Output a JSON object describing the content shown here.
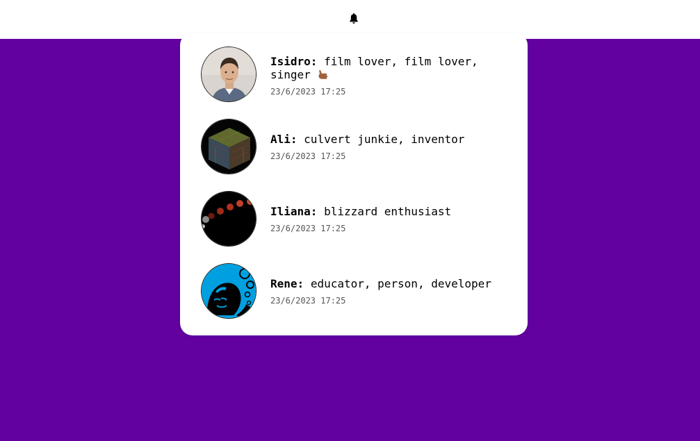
{
  "header": {
    "bell_icon": "bell-icon"
  },
  "notifications": [
    {
      "name": "Isidro:",
      "message": "film lover, film lover, singer",
      "emoji_icon": "call-me-hand-icon",
      "time": "23/6/2023 17:25"
    },
    {
      "name": "Ali:",
      "message": "culvert junkie, inventor",
      "time": "23/6/2023 17:25"
    },
    {
      "name": "Iliana:",
      "message": "blizzard enthusiast",
      "time": "23/6/2023 17:25"
    },
    {
      "name": "Rene:",
      "message": "educator, person, developer",
      "time": "23/6/2023 17:25"
    }
  ],
  "colors": {
    "background": "#6200a0",
    "panel": "#ffffff",
    "text": "#000000",
    "timestamp": "#555555"
  }
}
